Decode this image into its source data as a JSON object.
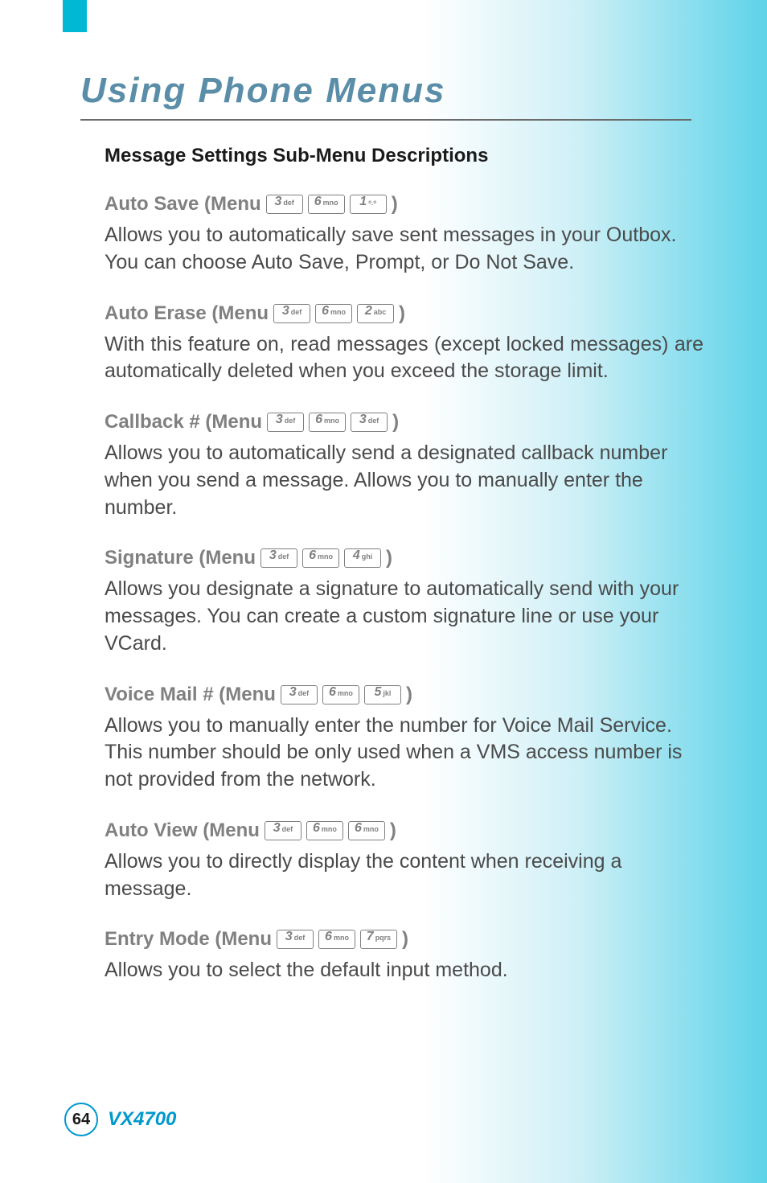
{
  "title": "Using Phone Menus",
  "sectionHeading": "Message Settings Sub-Menu Descriptions",
  "items": [
    {
      "label": "Auto Save (Menu",
      "keys": [
        {
          "big": "3",
          "small": "def"
        },
        {
          "big": "6",
          "small": "mno"
        },
        {
          "big": "1",
          "small": "ᵒ.ᵒ"
        }
      ],
      "body": "Allows you to automatically save sent messages in your Outbox. You can choose Auto Save, Prompt, or Do Not Save.",
      "justify": false
    },
    {
      "label": "Auto Erase (Menu",
      "keys": [
        {
          "big": "3",
          "small": "def"
        },
        {
          "big": "6",
          "small": "mno"
        },
        {
          "big": "2",
          "small": "abc"
        }
      ],
      "body": "With this feature on, read messages (except locked messages) are automatically deleted when you exceed the storage limit.",
      "justify": true
    },
    {
      "label": "Callback # (Menu",
      "keys": [
        {
          "big": "3",
          "small": "def"
        },
        {
          "big": "6",
          "small": "mno"
        },
        {
          "big": "3",
          "small": "def"
        }
      ],
      "body": "Allows you to automatically send a designated callback number when you send a message. Allows you to manually enter the number.",
      "justify": false
    },
    {
      "label": "Signature (Menu",
      "keys": [
        {
          "big": "3",
          "small": "def"
        },
        {
          "big": "6",
          "small": "mno"
        },
        {
          "big": "4",
          "small": "ghi"
        }
      ],
      "body": "Allows you designate a signature to automatically send with your messages. You can create a custom signature line or use your VCard.",
      "justify": false
    },
    {
      "label": "Voice Mail # (Menu",
      "keys": [
        {
          "big": "3",
          "small": "def"
        },
        {
          "big": "6",
          "small": "mno"
        },
        {
          "big": "5",
          "small": "jkl"
        }
      ],
      "body": "Allows you to manually enter the number for Voice Mail Service. This number should be only used when a VMS access number is not provided from the network.",
      "justify": false
    },
    {
      "label": "Auto View (Menu",
      "keys": [
        {
          "big": "3",
          "small": "def"
        },
        {
          "big": "6",
          "small": "mno"
        },
        {
          "big": "6",
          "small": "mno"
        }
      ],
      "body": "Allows you to directly display the content when receiving a message.",
      "justify": false
    },
    {
      "label": "Entry Mode (Menu",
      "keys": [
        {
          "big": "3",
          "small": "def"
        },
        {
          "big": "6",
          "small": "mno"
        },
        {
          "big": "7",
          "small": "pqrs"
        }
      ],
      "body": "Allows you to select the default input method.",
      "justify": false
    }
  ],
  "closeParen": ")",
  "pageNumber": "64",
  "model": "VX4700"
}
